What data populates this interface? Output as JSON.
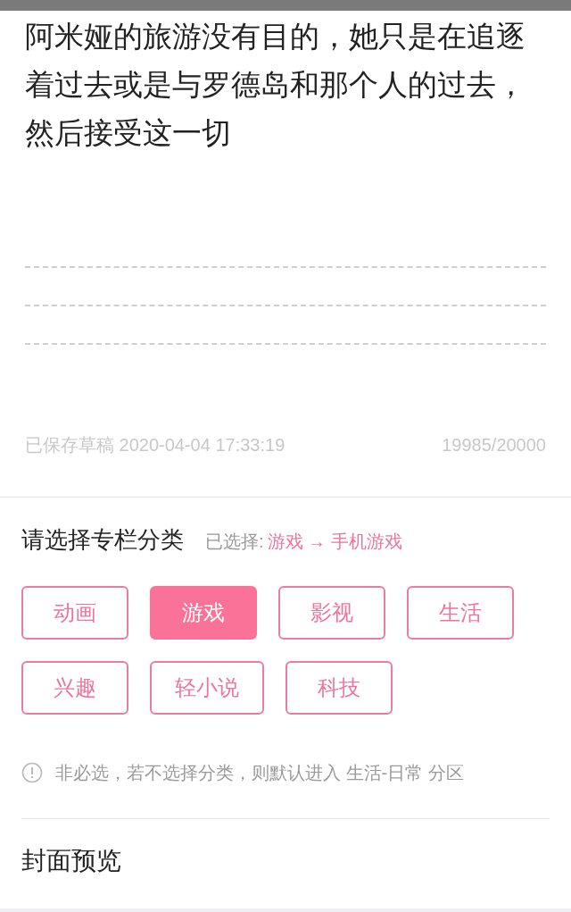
{
  "editor": {
    "body": "阿米娅的旅游没有目的，她只是在追逐着过去或是与罗德岛和那个人的过去，然后接受这一切",
    "draft_status": "已保存草稿 2020-04-04 17:33:19",
    "char_count": "19985/20000"
  },
  "category": {
    "title": "请选择专栏分类",
    "selected_label": "已选择:",
    "selected_path": "游戏 → 手机游戏",
    "options": [
      {
        "label": "动画",
        "selected": false
      },
      {
        "label": "游戏",
        "selected": true
      },
      {
        "label": "影视",
        "selected": false
      },
      {
        "label": "生活",
        "selected": false
      },
      {
        "label": "兴趣",
        "selected": false
      },
      {
        "label": "轻小说",
        "selected": false
      },
      {
        "label": "科技",
        "selected": false
      }
    ],
    "hint": "非必选，若不选择分类，则默认进入 生活-日常 分区"
  },
  "cover": {
    "title": "封面预览"
  }
}
